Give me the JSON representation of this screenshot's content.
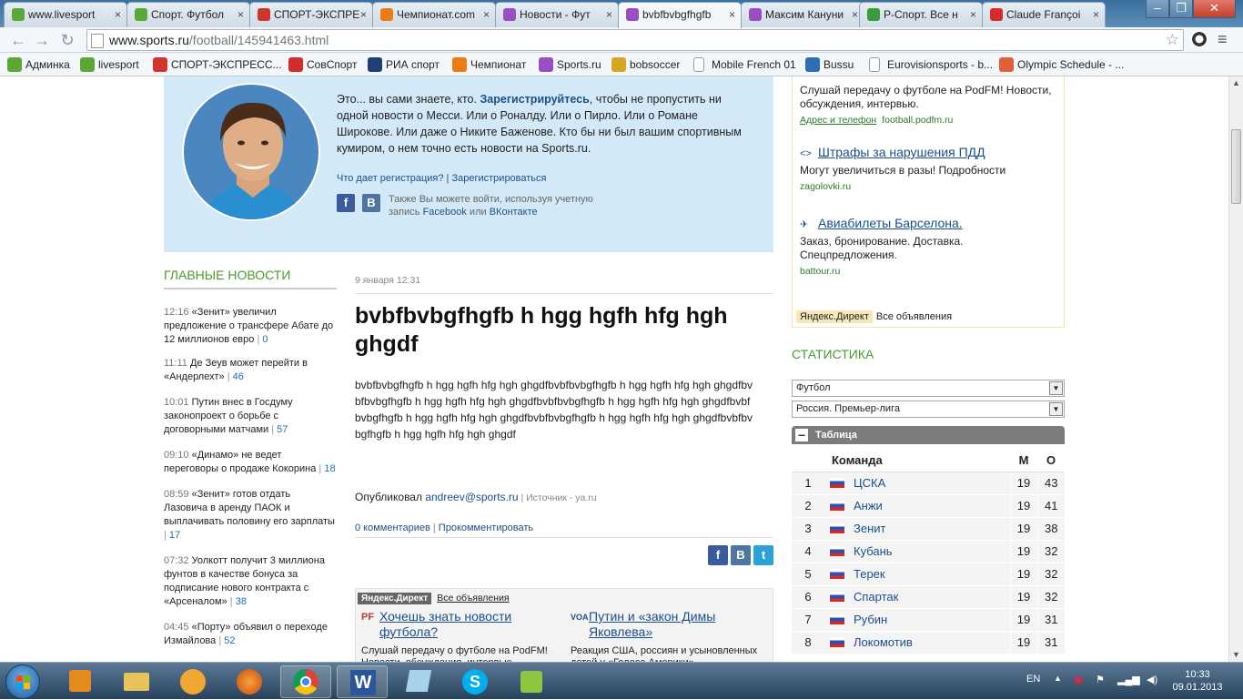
{
  "browser": {
    "tabs": [
      {
        "title": "www.livesport",
        "favicon_color": "#5aa836"
      },
      {
        "title": "Спорт. Футбол",
        "favicon_color": "#5aa836"
      },
      {
        "title": "СПОРТ-ЭКСПРЕ",
        "favicon_color": "#d0342c"
      },
      {
        "title": "Чемпионат.com",
        "favicon_color": "#f07a12"
      },
      {
        "title": "Новости - Фут",
        "favicon_color": "#9b4dc4"
      },
      {
        "title": "bvbfbvbgfhgfb",
        "favicon_color": "#9b4dc4"
      },
      {
        "title": "Максим Кануни",
        "favicon_color": "#9b4dc4"
      },
      {
        "title": "Р-Спорт. Все н",
        "favicon_color": "#3a9b3a"
      },
      {
        "title": "Claude Françoi",
        "favicon_color": "#d62b2b"
      }
    ],
    "url_host": "www.sports.ru",
    "url_path": "/football/145941463.html",
    "bookmarks": [
      {
        "label": "Админка",
        "icon": "globe-icon",
        "color": "#5aa836"
      },
      {
        "label": "livesport",
        "icon": "globe-icon",
        "color": "#5aa836"
      },
      {
        "label": "СПОРТ-ЭКСПРЕСС...",
        "icon": "globe-icon",
        "color": "#d0342c"
      },
      {
        "label": "СовСпорт",
        "icon": "sovsport-icon",
        "color": "#d62b2b"
      },
      {
        "label": "РИА спорт",
        "icon": "globe-icon",
        "color": "#1e3f78"
      },
      {
        "label": "Чемпионат",
        "icon": "ch-icon",
        "color": "#f07a12"
      },
      {
        "label": "Sports.ru",
        "icon": "flower-icon",
        "color": "#9b4dc4"
      },
      {
        "label": "bobsoccer",
        "icon": "ball-icon",
        "color": "#d8a620"
      },
      {
        "label": "Mobile French 01",
        "icon": "page-icon",
        "color": "#ffffff"
      },
      {
        "label": "Bussu",
        "icon": "b-icon",
        "color": "#2d6fb2"
      },
      {
        "label": "Eurovisionsports - b...",
        "icon": "page-icon",
        "color": "#ffffff"
      },
      {
        "label": "Olympic Schedule - ...",
        "icon": "olympic-icon",
        "color": "#e0603a"
      }
    ]
  },
  "promo": {
    "text_before": "Это... вы сами знаете, кто. ",
    "register_link": "Зарегистрируйтесь",
    "text_after": ", чтобы не пропустить ни одной новости о Месси. Или о Роналду. Или о Пирло. Или о Романе Широкове. Или даже о Никите Баженове. Кто бы ни был вашим спортивным кумиром, о нем точно есть новости на Sports.ru.",
    "what_gives": "Что дает регистрация?",
    "register2": "Зарегистрироваться",
    "also_text": "Также Вы можете войти, используя учетную запись ",
    "facebook": "Facebook",
    "or": " или ",
    "vkontakte": "ВКонтакте",
    "close": "×"
  },
  "main_news": {
    "title": "ГЛАВНЫЕ НОВОСТИ",
    "items": [
      {
        "time": "12:16",
        "text": "«Зенит» увеличил предложение о трансфере Абате до 12 миллионов евро",
        "comments": "0"
      },
      {
        "time": "11:11",
        "text": "Де Зеув может перейти в «Андерлехт»",
        "comments": "46"
      },
      {
        "time": "10:01",
        "text": "Путин внес в Госдуму законопроект о борьбе с договорными матчами",
        "comments": "57"
      },
      {
        "time": "09:10",
        "text": "«Динамо» не ведет переговоры о продаже Кокорина",
        "comments": "18"
      },
      {
        "time": "08:59",
        "text": "«Зенит» готов отдать Лазовича в аренду ПАОК и выплачивать половину его зарплаты",
        "comments": "17"
      },
      {
        "time": "07:32",
        "text": "Уолкотт получит 3 миллиона фунтов в качестве бонуса за подписание нового контракта с «Арсеналом»",
        "comments": "38"
      },
      {
        "time": "04:45",
        "text": "«Порту» объявил о переходе Измайлова",
        "comments": "52"
      }
    ]
  },
  "article": {
    "date": "9 января 12:31",
    "title": "bvbfbvbgfhgfb h hgg hgfh hfg hgh ghgdf",
    "body": "bvbfbvbgfhgfb h hgg hgfh hfg hgh ghgdfbvbfbvbgfhgfb h hgg hgfh hfg hgh ghgdfbvbfbvbgfhgfb h hgg hgfh hfg hgh ghgdfbvbfbvbgfhgfb h hgg hgfh hfg hgh ghgdfbvbfbvbgfhgfb h hgg hgfh hfg hgh ghgdfbvbfbvbgfhgfb h hgg hgfh hfg hgh ghgdfbvbfbvbgfhgfb h hgg hgfh hfg hgh ghgdf",
    "published_label": "Опубликовал ",
    "author": "andreev@sports.ru",
    "source": " | Источник - ya.ru",
    "comments_link": "0 комментариев",
    "comment_link": "Прокомментировать"
  },
  "direct_bottom": {
    "label": "Яндекс.Директ",
    "all": "Все объявления",
    "ads": [
      {
        "icon": "PF",
        "title": "Хочешь знать новости футбола?",
        "desc": "Слушай передачу о футболе на PodFM! Новости, обсуждения, интервью."
      },
      {
        "icon": "VOA",
        "title": "Путин и «закон Димы Яковлева»",
        "desc": "Реакция США, россиян и усыновленных детей у «Голоса Америки»"
      }
    ]
  },
  "ads_right": {
    "ads": [
      {
        "desc": "Слушай передачу о футболе на PodFM! Новости, обсуждения, интервью.",
        "link": "Адрес и телефон",
        "url": "football.podfm.ru"
      },
      {
        "title": "Штрафы за нарушения ПДД",
        "desc": "Могут увеличиться в разы! Подробности",
        "url": "zagolovki.ru"
      },
      {
        "title": "Авиабилеты Барселона.",
        "desc": "Заказ, бронирование. Доставка. Спецпредложения.",
        "url": "battour.ru"
      }
    ],
    "label": "Яндекс.Директ",
    "all": "Все объявления"
  },
  "stats": {
    "title": "СТАТИСТИКА",
    "sport_select": "Футбол",
    "league_select": "Россия. Премьер-лига",
    "table_toggle": "Таблица",
    "columns": [
      "Команда",
      "М",
      "О"
    ],
    "rows": [
      {
        "pos": "1",
        "team": "ЦСКА",
        "m": "19",
        "o": "43"
      },
      {
        "pos": "2",
        "team": "Анжи",
        "m": "19",
        "o": "41"
      },
      {
        "pos": "3",
        "team": "Зенит",
        "m": "19",
        "o": "38"
      },
      {
        "pos": "4",
        "team": "Кубань",
        "m": "19",
        "o": "32"
      },
      {
        "pos": "5",
        "team": "Терек",
        "m": "19",
        "o": "32"
      },
      {
        "pos": "6",
        "team": "Спартак",
        "m": "19",
        "o": "32"
      },
      {
        "pos": "7",
        "team": "Рубин",
        "m": "19",
        "o": "31"
      },
      {
        "pos": "8",
        "team": "Локомотив",
        "m": "19",
        "o": "31"
      }
    ]
  },
  "taskbar": {
    "lang": "EN",
    "time": "10:33",
    "date": "09.01.2013"
  }
}
